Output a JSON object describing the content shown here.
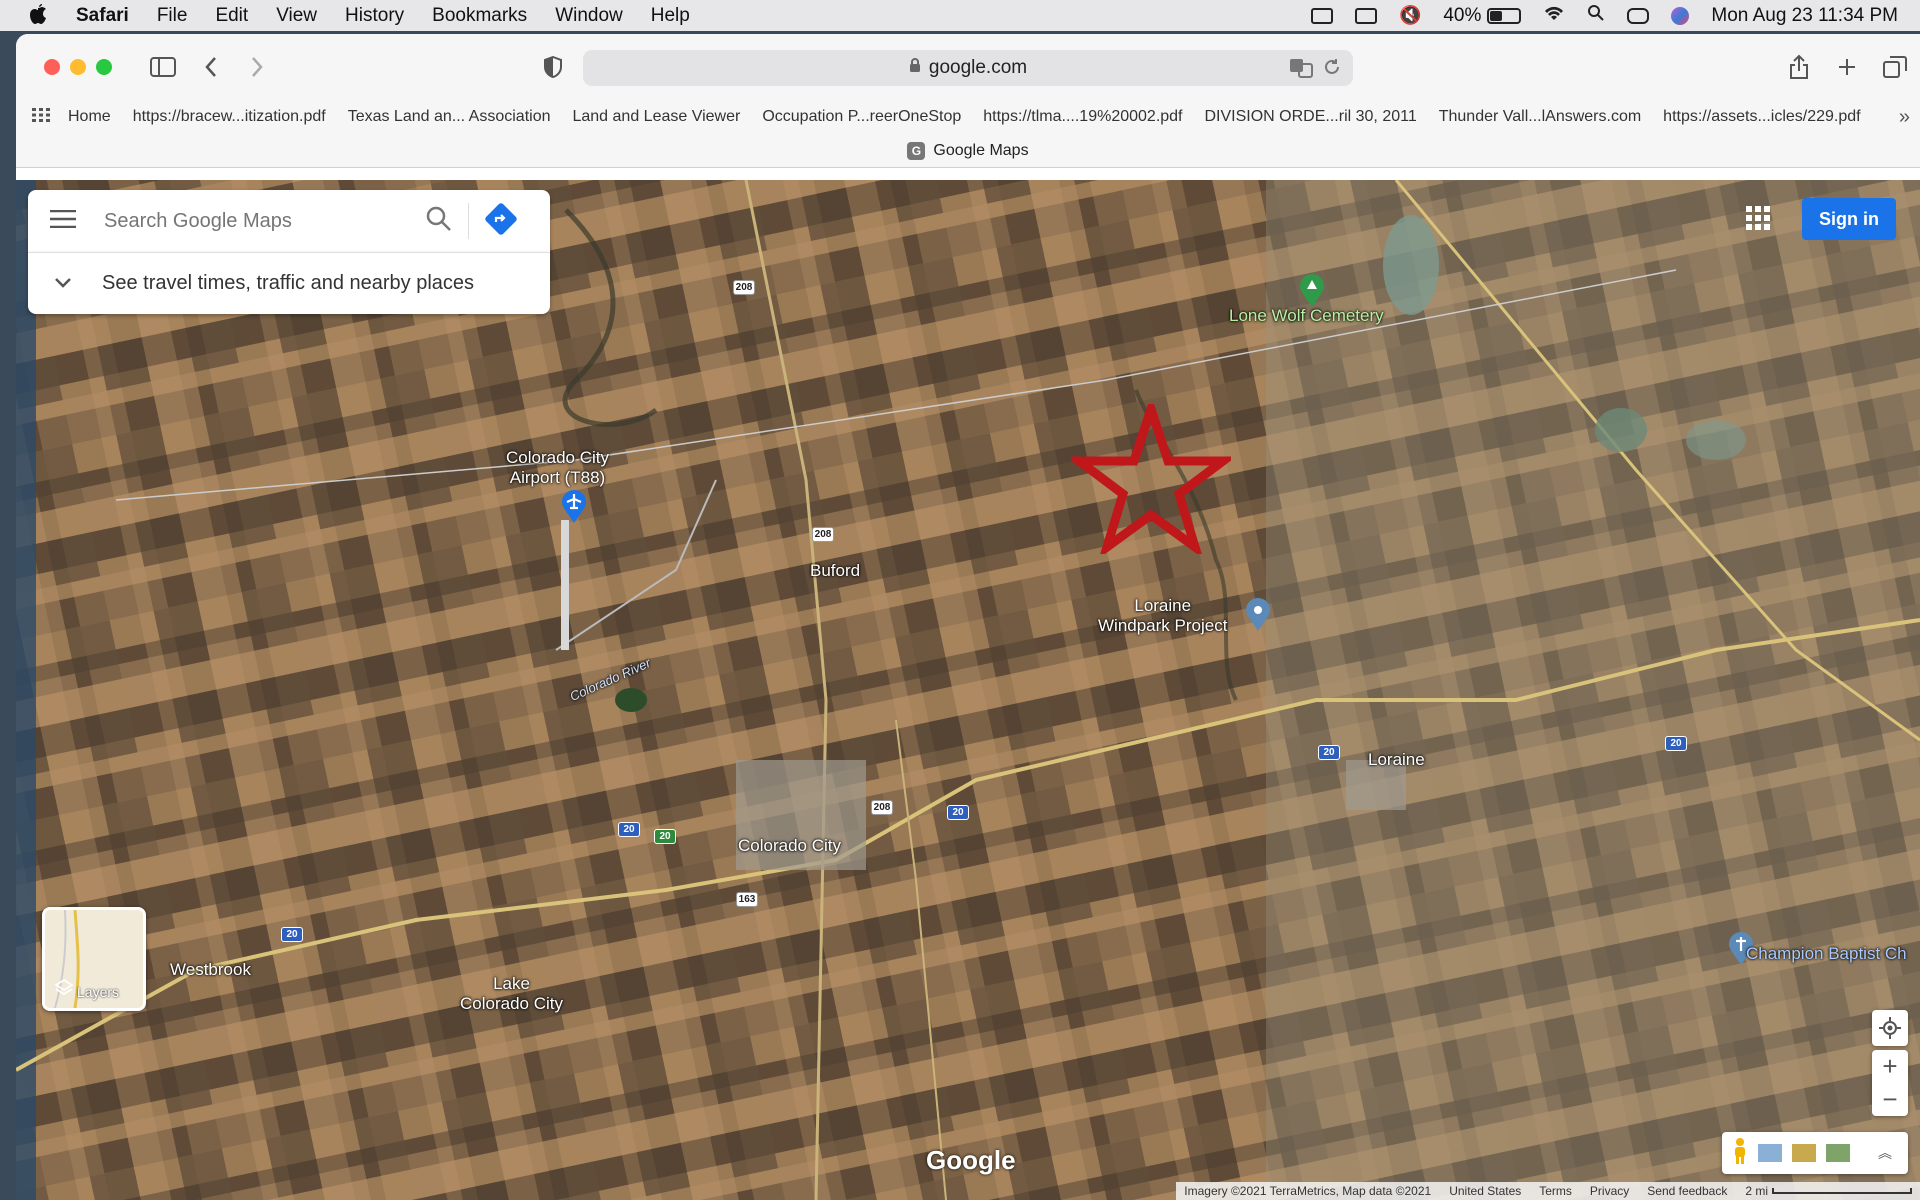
{
  "menubar": {
    "app_name": "Safari",
    "menus": [
      "File",
      "Edit",
      "View",
      "History",
      "Bookmarks",
      "Window",
      "Help"
    ],
    "battery_percent": "40%",
    "battery_level": 0.4,
    "clock": "Mon Aug 23  11:34 PM"
  },
  "browser": {
    "url": "google.com",
    "bookmarks": [
      "Home",
      "https://bracew...itization.pdf",
      "Texas Land an... Association",
      "Land and Lease Viewer",
      "Occupation P...reerOneStop",
      "https://tlma....19%20002.pdf",
      "DIVISION ORDE...ril 30, 2011",
      "Thunder Vall...lAnswers.com",
      "https://assets...icles/229.pdf"
    ],
    "tab_title": "Google Maps",
    "tab_favicon": "G"
  },
  "maps": {
    "search_placeholder": "Search Google Maps",
    "travel_text": "See travel times, traffic and nearby places",
    "sign_in": "Sign in",
    "layers_label": "Layers",
    "google_logo": "Google",
    "places": {
      "lone_wolf": "Lone Wolf Cemetery",
      "airport": "Colorado City\nAirport (T88)",
      "buford": "Buford",
      "windpark": "Loraine\nWindpark Project",
      "colorado_river": "Colorado River",
      "loraine": "Loraine",
      "colorado_city": "Colorado City",
      "westbrook": "Westbrook",
      "lake": "Lake\nColorado City",
      "church": "Champion Baptist Ch"
    },
    "shields": [
      "208",
      "208",
      "208",
      "20",
      "20",
      "20",
      "20",
      "20",
      "163",
      "20"
    ],
    "footer": {
      "imagery": "Imagery ©2021 TerraMetrics, Map data ©2021",
      "country": "United States",
      "terms": "Terms",
      "privacy": "Privacy",
      "feedback": "Send feedback",
      "scale": "2 mi"
    },
    "colors": {
      "star": "#c0171b",
      "sign_in": "#1a73e8",
      "directions": "#1a73e8"
    }
  }
}
